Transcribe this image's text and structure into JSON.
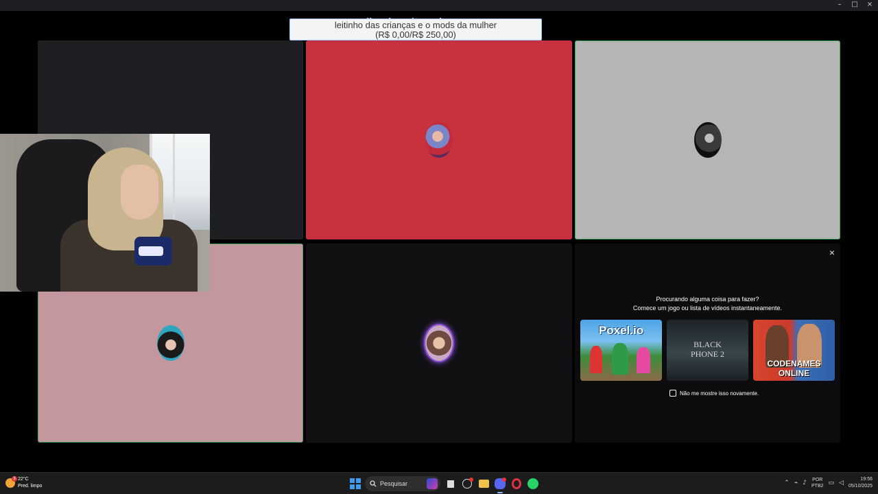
{
  "window": {
    "controls": {
      "minimize": "–",
      "maximize": "□",
      "close": "×"
    }
  },
  "overlay": {
    "url": "livepix.gg/nagadrama",
    "goal_title": "leitinho das crianças e o mods da mulher",
    "goal_progress": "(R$ 0,00/R$ 250,00)",
    "goal_raised": 0,
    "goal_target": 250
  },
  "tiles": [
    {
      "id": "empty",
      "color": "#1e1f22",
      "speaking": false
    },
    {
      "id": "red",
      "color": "#c7323e",
      "speaking": false
    },
    {
      "id": "gray",
      "color": "#b5b5b5",
      "speaking": true
    },
    {
      "id": "pink",
      "color": "#c4979f",
      "speaking": true
    },
    {
      "id": "dark",
      "color": "#111114",
      "speaking": false,
      "ring": "#9a59ff"
    }
  ],
  "activity": {
    "close_label": "×",
    "prompt_line1": "Procurando alguma coisa para fazer?",
    "prompt_line2": "Comece um jogo ou lista de vídeos instantaneamente.",
    "cards": [
      {
        "title": "Poxel.io"
      },
      {
        "title": "BLACK",
        "subtitle": "PHONE 2"
      },
      {
        "title": "CODENAMES ONLINE"
      }
    ],
    "dont_show_label": "Não me mostre isso novamente."
  },
  "taskbar": {
    "weather_temp": "22°C",
    "weather_desc": "Pred. limpo",
    "weather_badge": "3",
    "search_placeholder": "Pesquisar",
    "language": "POR",
    "layout": "PTB2",
    "time": "19:56",
    "date": "05/10/2025"
  },
  "colors": {
    "speaking_border": "#3ba55c",
    "taskbar_bg": "#1c1c1c",
    "accent": "#3b9cf0"
  }
}
